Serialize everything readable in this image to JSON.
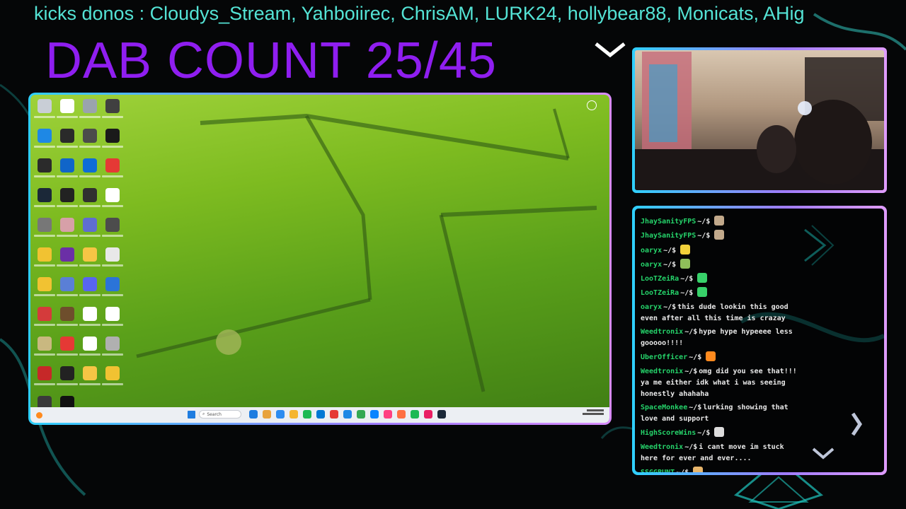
{
  "ticker": {
    "text": "kicks donos : Cloudys_Stream, Yahboiirec, ChrisAM, LURK24, hollybear88, Monicats, AHig"
  },
  "overlay": {
    "dab_count": "DAB COUNT 25/45"
  },
  "desktop": {
    "icons": [
      {
        "color": "#c9ced6"
      },
      {
        "color": "#ffffff"
      },
      {
        "color": "#9aa3ad"
      },
      {
        "color": "#404040"
      },
      {
        "color": "#1e88e5"
      },
      {
        "color": "#2a2a2a"
      },
      {
        "color": "#4b4b4b"
      },
      {
        "color": "#1a1a1a"
      },
      {
        "color": "#2b2b2b"
      },
      {
        "color": "#1065c9"
      },
      {
        "color": "#0e6cd6"
      },
      {
        "color": "#e53935"
      },
      {
        "color": "#1b2838"
      },
      {
        "color": "#222222"
      },
      {
        "color": "#303030"
      },
      {
        "color": "#ffffff"
      },
      {
        "color": "#777777"
      },
      {
        "color": "#d7a0a8"
      },
      {
        "color": "#5f6dd1"
      },
      {
        "color": "#4c4c4c"
      },
      {
        "color": "#f1c232"
      },
      {
        "color": "#6b2fa6"
      },
      {
        "color": "#f6c545"
      },
      {
        "color": "#e8e8e8"
      },
      {
        "color": "#f1c232"
      },
      {
        "color": "#5a7fd6"
      },
      {
        "color": "#5865f2"
      },
      {
        "color": "#2b74d8"
      },
      {
        "color": "#d43b3b"
      },
      {
        "color": "#6e4e2c"
      },
      {
        "color": "#ffffff"
      },
      {
        "color": "#ffffff"
      },
      {
        "color": "#c9b880"
      },
      {
        "color": "#e53935"
      },
      {
        "color": "#ffffff"
      },
      {
        "color": "#b0b0b0"
      },
      {
        "color": "#c62828"
      },
      {
        "color": "#222222"
      },
      {
        "color": "#f6c545"
      },
      {
        "color": "#f1c232"
      },
      {
        "color": "#3a3a3a"
      },
      {
        "color": "#111111"
      }
    ],
    "taskbar": {
      "search_placeholder": "Search",
      "apps": [
        "#1f7de0",
        "#e8a33d",
        "#2d8cf0",
        "#f5b52e",
        "#1db954",
        "#0078d4",
        "#e53935",
        "#1e88e5",
        "#34a853",
        "#0a84ff",
        "#ff4081",
        "#ff7043",
        "#1db954",
        "#e91e63",
        "#1b2838"
      ]
    }
  },
  "chat": {
    "messages": [
      {
        "user": "JhaySanityFPS",
        "prompt": "~/$",
        "text": "",
        "emote": "#c2a98b"
      },
      {
        "user": "JhaySanityFPS",
        "prompt": "~/$",
        "text": "",
        "emote": "#c2a98b"
      },
      {
        "user": "oaryx",
        "prompt": "~/$",
        "text": "",
        "emote": "#f2d13a"
      },
      {
        "user": "oaryx",
        "prompt": "~/$",
        "text": "",
        "emote": "#8fbf5a"
      },
      {
        "user": "LooTZeiRa",
        "prompt": "~/$",
        "text": "",
        "emote": "#38d16a"
      },
      {
        "user": "LooTZeiRa",
        "prompt": "~/$",
        "text": "",
        "emote": "#38d16a"
      },
      {
        "user": "oaryx",
        "prompt": "~/$",
        "text": "this dude lookin this good even after all this time is crazay",
        "emote": ""
      },
      {
        "user": "Weedtronix",
        "prompt": "~/$",
        "text": "hype hype hypeeee less gooooo!!!!",
        "emote": ""
      },
      {
        "user": "UberOfficer",
        "prompt": "~/$",
        "text": "",
        "emote": "#ff8a1e"
      },
      {
        "user": "Weedtronix",
        "prompt": "~/$",
        "text": "omg did you see that!!! ya me either idk what i was seeing honestly ahahaha",
        "emote": ""
      },
      {
        "user": "SpaceMonkee",
        "prompt": "~/$",
        "text": "lurking showing that love and support",
        "emote": ""
      },
      {
        "user": "HighScoreWins",
        "prompt": "~/$",
        "text": "",
        "emote": "#dcdcdc"
      },
      {
        "user": "Weedtronix",
        "prompt": "~/$",
        "text": "i cant move im stuck here for ever and ever....",
        "emote": ""
      },
      {
        "user": "SSGGRUNT",
        "prompt": "~/$",
        "text": "",
        "emote": "#e7b56b"
      }
    ]
  }
}
